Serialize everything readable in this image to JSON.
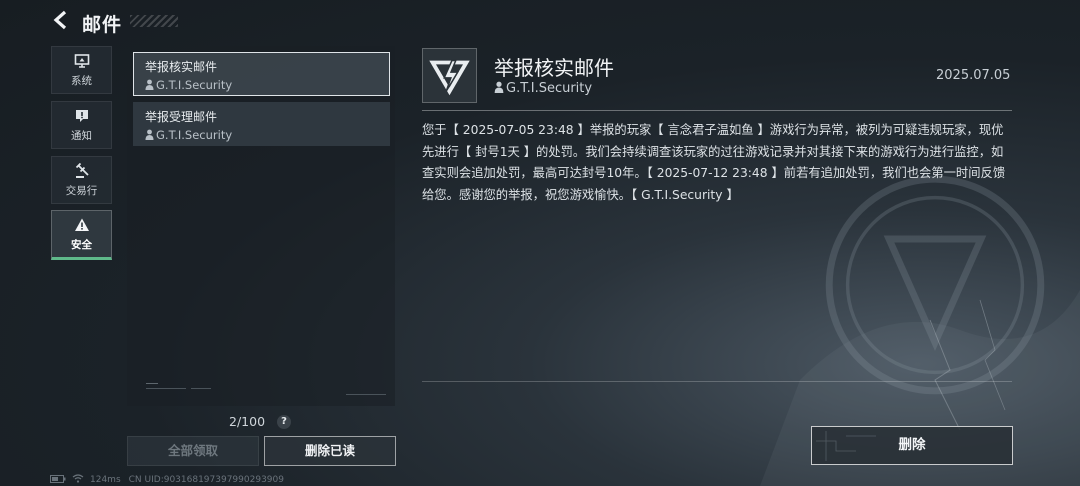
{
  "header": {
    "title": "邮件"
  },
  "tabs": [
    {
      "label": "系统",
      "icon": "monitor-icon",
      "active": false
    },
    {
      "label": "通知",
      "icon": "alert-box-icon",
      "active": false
    },
    {
      "label": "交易行",
      "icon": "gavel-icon",
      "active": false
    },
    {
      "label": "安全",
      "icon": "warning-triangle-icon",
      "active": true
    }
  ],
  "mail_list": [
    {
      "subject": "举报核实邮件",
      "sender": "G.T.I.Security",
      "selected": true
    },
    {
      "subject": "举报受理邮件",
      "sender": "G.T.I.Security",
      "selected": false
    }
  ],
  "mail_count": "2/100",
  "help_label": "?",
  "buttons": {
    "claim_all": "全部领取",
    "delete_read": "删除已读",
    "delete": "删除"
  },
  "detail": {
    "subject": "举报核实邮件",
    "sender": "G.T.I.Security",
    "date": "2025.07.05",
    "body": "您于【 2025-07-05 23:48 】举报的玩家【 言念君子温如鱼 】游戏行为异常，被列为可疑违规玩家，现优先进行【 封号1天 】的处罚。我们会持续调查该玩家的过往游戏记录并对其接下来的游戏行为进行监控，如查实则会追加处罚，最高可达封号10年。【 2025-07-12 23:48 】前若有追加处罚，我们也会第一时间反馈给您。感谢您的举报，祝您游戏愉快。【 G.T.I.Security 】"
  },
  "footer": {
    "ping": "124ms",
    "uid": "CN UID:903168197397990293909"
  },
  "colors": {
    "accent": "#5fb98a",
    "background": "#1b2228"
  }
}
